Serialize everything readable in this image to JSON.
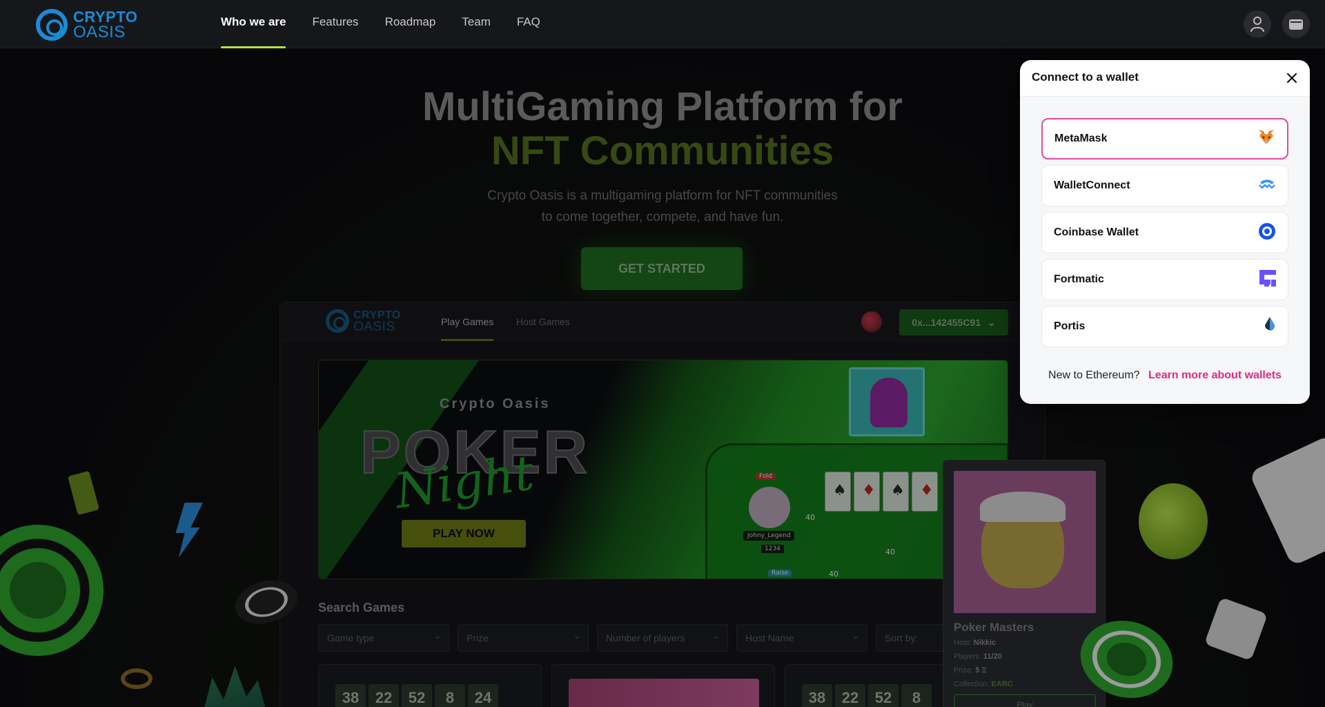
{
  "brand": {
    "line1": "CRYPTO",
    "line2": "OASIS",
    "color": "#1b8bd6"
  },
  "nav": {
    "links": [
      "Who we are",
      "Features",
      "Roadmap",
      "Team",
      "FAQ"
    ],
    "active_index": 0,
    "icons": [
      "user-icon",
      "wallet-icon"
    ]
  },
  "hero": {
    "title_line1": "MultiGaming Platform for",
    "title_line2": "NFT Communities",
    "subtitle_line1": "Crypto Oasis is a multigaming platform for NFT communities",
    "subtitle_line2": "to come together, compete, and have fun.",
    "cta": "GET STARTED"
  },
  "app_preview": {
    "brand": {
      "line1": "CRYPTO",
      "line2": "OASIS"
    },
    "tabs": [
      "Play Games",
      "Host Games"
    ],
    "address": "0x...142455C91",
    "banner": {
      "small_title": "Crypto Oasis",
      "big_title": "POKER",
      "script_title": "Night",
      "button": "PLAY NOW"
    },
    "search_title": "Search Games",
    "filters": [
      "Game type",
      "Prize",
      "Number of players",
      "Host Name",
      "Sort by:"
    ],
    "countdowns": [
      [
        "38",
        "22",
        "52",
        "8",
        "24"
      ],
      [
        "38",
        "22",
        "52",
        "8"
      ]
    ],
    "table": {
      "player_name": "Johny_Legend",
      "player_chips": "1234",
      "fold_label": "Fold",
      "raise_label": "Raise",
      "bets": [
        "40",
        "40",
        "40"
      ]
    }
  },
  "game_card": {
    "title": "Poker Masters",
    "host_label": "Host:",
    "host": "Nikkic",
    "players_label": "Players:",
    "players": "11/20",
    "prize_label": "Prize:",
    "prize": "5 Ξ",
    "collection_label": "Collection:",
    "collection": "EARC",
    "button": "Play"
  },
  "wallet_modal": {
    "title": "Connect to a wallet",
    "options": [
      {
        "label": "MetaMask",
        "icon": "metamask-fox-icon",
        "selected": true
      },
      {
        "label": "WalletConnect",
        "icon": "walletconnect-icon",
        "selected": false
      },
      {
        "label": "Coinbase Wallet",
        "icon": "coinbase-icon",
        "selected": false
      },
      {
        "label": "Fortmatic",
        "icon": "fortmatic-icon",
        "selected": false
      },
      {
        "label": "Portis",
        "icon": "portis-icon",
        "selected": false
      }
    ],
    "footer_text": "New to Ethereum?",
    "footer_link": "Learn more about wallets"
  },
  "colors": {
    "accent_green": "#b6e33a",
    "cta_green": "#1f6b21",
    "modal_selected_border": "#e0489e",
    "link_pink": "#e0288a"
  }
}
